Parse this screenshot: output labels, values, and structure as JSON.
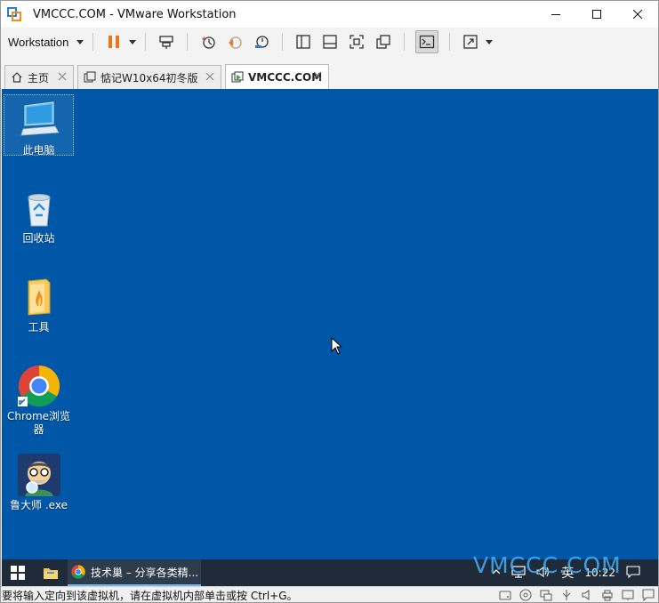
{
  "window": {
    "title": "VMCCC.COM - VMware Workstation"
  },
  "toolbar": {
    "menu_label": "Workstation"
  },
  "tabs": [
    {
      "label": "主页"
    },
    {
      "label": "惦记W10x64初冬版"
    },
    {
      "label": "VMCCC.COM"
    }
  ],
  "desktop": {
    "icons": [
      {
        "label": "此电脑",
        "icon": "computer-icon"
      },
      {
        "label": "回收站",
        "icon": "recycle-bin-icon"
      },
      {
        "label": "工具",
        "icon": "folder-icon"
      },
      {
        "label": "Chrome浏览器",
        "icon": "chrome-icon"
      },
      {
        "label": "鲁大师 .exe",
        "icon": "ludashi-icon"
      }
    ]
  },
  "taskbar": {
    "chrome_task_title": "技术巢 – 分享各类精...",
    "ime": "英",
    "clock": "10:22"
  },
  "watermark": "VMCCC.COM",
  "statusbar": {
    "text": "要将输入定向到该虚拟机，请在虚拟机内部单击或按 Ctrl+G。"
  },
  "colors": {
    "desktop_bg": "#0057a8",
    "taskbar_bg": "#1f2b38",
    "watermark": "#3fb0ff",
    "pause_orange": "#e8781e"
  }
}
